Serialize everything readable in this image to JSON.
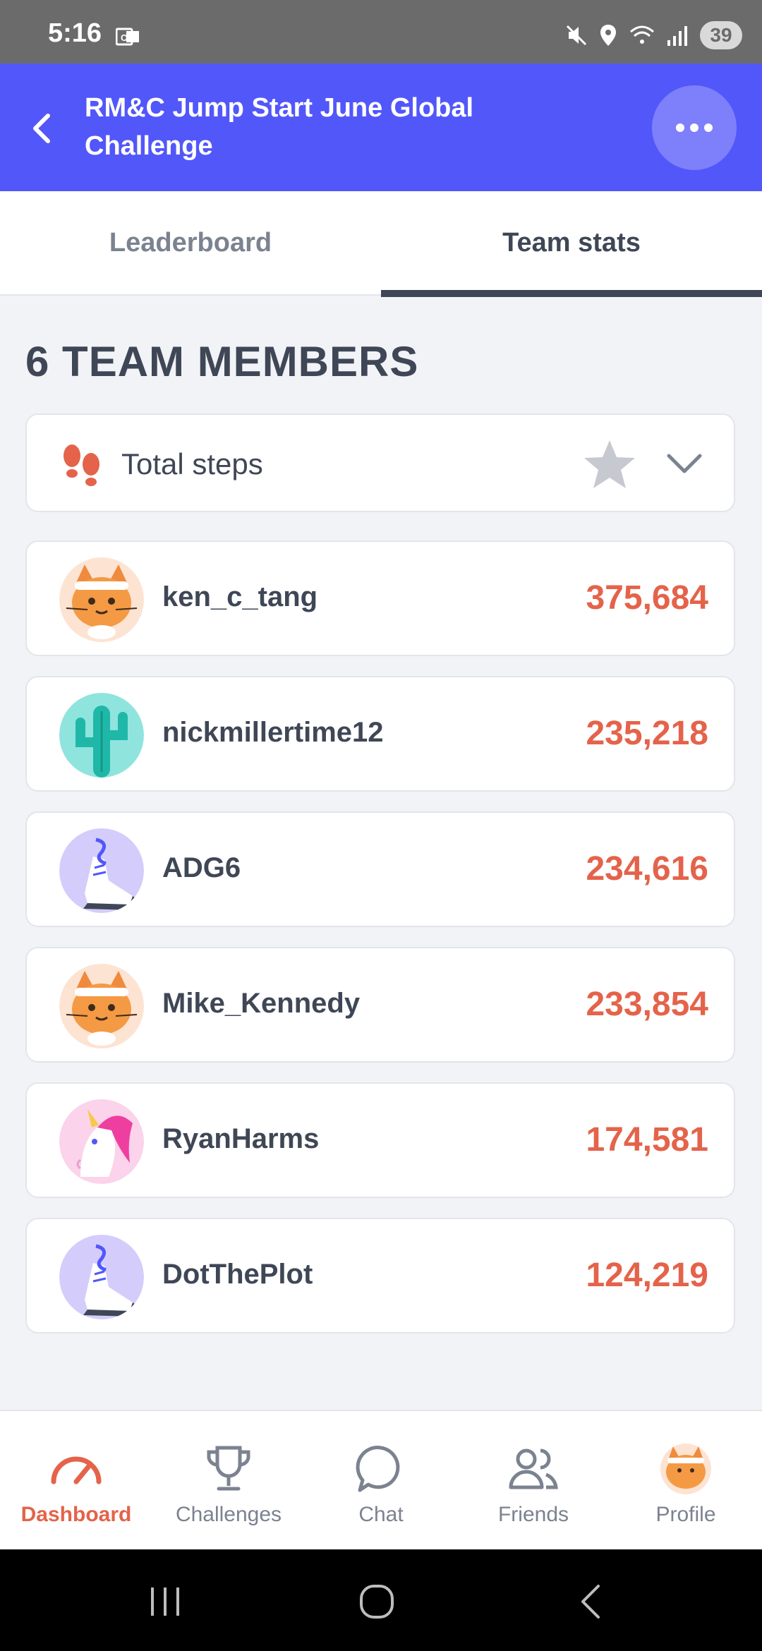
{
  "status_bar": {
    "time": "5:16",
    "battery": "39"
  },
  "header": {
    "title": "RM&C Jump Start June Global Challenge"
  },
  "tabs": [
    {
      "label": "Leaderboard",
      "active": false
    },
    {
      "label": "Team stats",
      "active": true
    }
  ],
  "section_title": "6 TEAM MEMBERS",
  "metric": {
    "label": "Total steps"
  },
  "members": [
    {
      "name": "ken_c_tang",
      "steps": "375,684",
      "avatar": "cat-icon"
    },
    {
      "name": "nickmillertime12",
      "steps": "235,218",
      "avatar": "cactus-icon"
    },
    {
      "name": "ADG6",
      "steps": "234,616",
      "avatar": "sneaker-icon"
    },
    {
      "name": "Mike_Kennedy",
      "steps": "233,854",
      "avatar": "cat-icon"
    },
    {
      "name": "RyanHarms",
      "steps": "174,581",
      "avatar": "unicorn-icon"
    },
    {
      "name": "DotThePlot",
      "steps": "124,219",
      "avatar": "sneaker-icon"
    }
  ],
  "bottom_nav": [
    {
      "label": "Dashboard",
      "icon": "speedometer-icon",
      "active": true
    },
    {
      "label": "Challenges",
      "icon": "trophy-icon",
      "active": false
    },
    {
      "label": "Chat",
      "icon": "chat-bubble-icon",
      "active": false
    },
    {
      "label": "Friends",
      "icon": "friends-icon",
      "active": false
    },
    {
      "label": "Profile",
      "icon": "avatar",
      "active": false
    }
  ],
  "colors": {
    "header_bg": "#5257fa",
    "accent_orange": "#e4634a",
    "text_dark": "#3f4756"
  }
}
